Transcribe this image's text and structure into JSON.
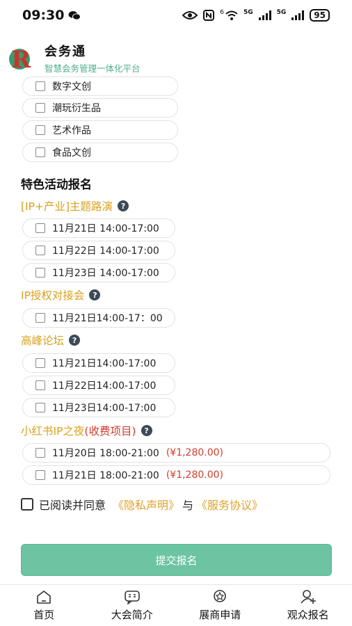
{
  "status": {
    "time": "09:30",
    "battery": "95",
    "net1": "5G",
    "net2": "5G",
    "wifi_gen": "6"
  },
  "header": {
    "app_name": "会务通",
    "slogan": "智慧会务管理一体化平台"
  },
  "categories": [
    {
      "label": "数字文创"
    },
    {
      "label": "潮玩衍生品"
    },
    {
      "label": "艺术作品"
    },
    {
      "label": "食品文创"
    }
  ],
  "section_title": "特色活动报名",
  "events": [
    {
      "title": "[IP+产业]主题路演",
      "slots": [
        {
          "label": "11月21日 14:00-17:00"
        },
        {
          "label": "11月22日 14:00-17:00"
        },
        {
          "label": "11月23日 14:00-17:00"
        }
      ]
    },
    {
      "title": "IP授权对接会",
      "slots": [
        {
          "label": "11月21日14:00-17：00"
        }
      ]
    },
    {
      "title": "高峰论坛",
      "slots": [
        {
          "label": "11月21日14:00-17:00"
        },
        {
          "label": "11月22日14:00-17:00"
        },
        {
          "label": "11月23日14:00-17:00"
        }
      ]
    },
    {
      "title": "小红书IP之夜",
      "title_paid": "(收费项目)",
      "slots": [
        {
          "label": "11月20日 18:00-21:00",
          "price": "(¥1,280.00)"
        },
        {
          "label": "11月21日 18:00-21:00",
          "price": "(¥1,280.00)"
        }
      ]
    }
  ],
  "agreement": {
    "prefix": "已阅读并同意",
    "privacy": "《隐私声明》",
    "and": "与",
    "service": "《服务协议》"
  },
  "submit_label": "提交报名",
  "tabs": [
    {
      "label": "首页",
      "icon": "home-icon"
    },
    {
      "label": "大会简介",
      "icon": "chat-icon"
    },
    {
      "label": "展商申请",
      "icon": "star-icon"
    },
    {
      "label": "观众报名",
      "icon": "user-add-icon"
    }
  ],
  "colors": {
    "accent": "#6cc4a2",
    "gold": "#d9a11c",
    "price": "#d23c2c",
    "link": "#e0a12a"
  }
}
